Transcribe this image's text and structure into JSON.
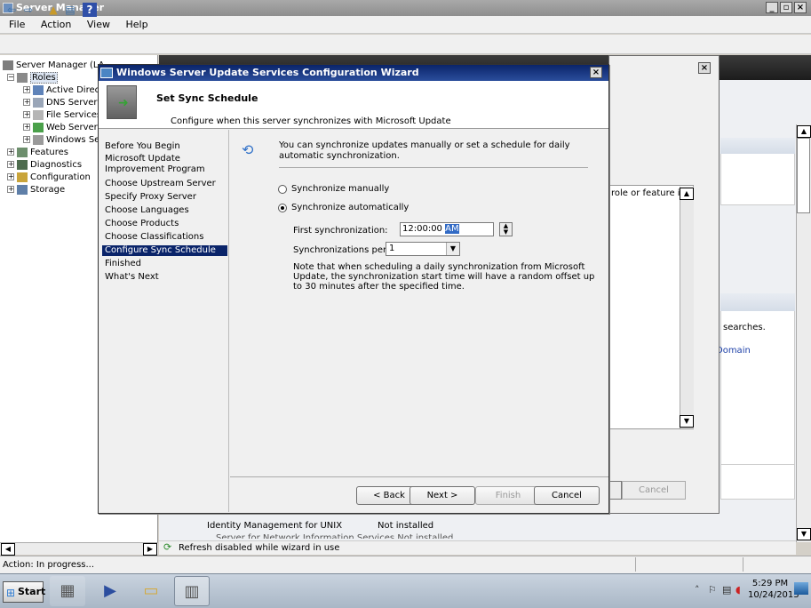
{
  "main_window": {
    "title": "Server Manager",
    "menu": [
      "File",
      "Action",
      "View",
      "Help"
    ]
  },
  "tree": {
    "root": "Server Manager (LA",
    "roles": "Roles",
    "role_items": [
      "Active Direct",
      "DNS Server",
      "File Services",
      "Web Server",
      "Windows Se"
    ],
    "features": "Features",
    "diagnostics": "Diagnostics",
    "configuration": "Configuration",
    "storage": "Storage"
  },
  "background": {
    "role_or_feature_text": "role or feature is",
    "searches_text": "searches.",
    "domain_link": "Domain",
    "cancel_label": "Cancel",
    "role_row_name": "Identity Management for UNIX",
    "role_row_status": "Not installed",
    "role_row2_partial": "Server for Network Information Services   Not installed",
    "refresh_text": "Refresh disabled while wizard in use"
  },
  "status_bar": {
    "text": "Action:  In progress..."
  },
  "taskbar": {
    "start_label": "Start",
    "time": "5:29 PM",
    "date": "10/24/2013"
  },
  "wizard": {
    "title": "Windows Server Update Services Configuration Wizard",
    "page_title": "Set Sync Schedule",
    "page_description": "Configure when this server synchronizes with Microsoft Update",
    "nav": [
      "Before You Begin",
      "Microsoft Update Improvement Program",
      "Choose Upstream Server",
      "Specify Proxy Server",
      "Choose Languages",
      "Choose Products",
      "Choose Classifications",
      "Configure Sync Schedule",
      "Finished",
      "What's Next"
    ],
    "intro": "You can synchronize updates manually or set a schedule for daily automatic synchronization.",
    "radio_manual": "Synchronize manually",
    "radio_auto": "Synchronize automatically",
    "first_sync_label": "First synchronization:",
    "first_sync_time": "12:00:00",
    "first_sync_ampm": "AM",
    "per_day_label": "Synchronizations per day:",
    "per_day_value": "1",
    "note": "Note that when scheduling a daily synchronization from Microsoft Update, the synchronization start time will have a random offset up to 30 minutes after the specified time.",
    "buttons": {
      "back": "< Back",
      "next": "Next >",
      "finish": "Finish",
      "cancel": "Cancel"
    }
  },
  "colors": {
    "selection": "#0a246a",
    "title_gradient": "#2b4e9c",
    "link": "#1c3fa7"
  }
}
